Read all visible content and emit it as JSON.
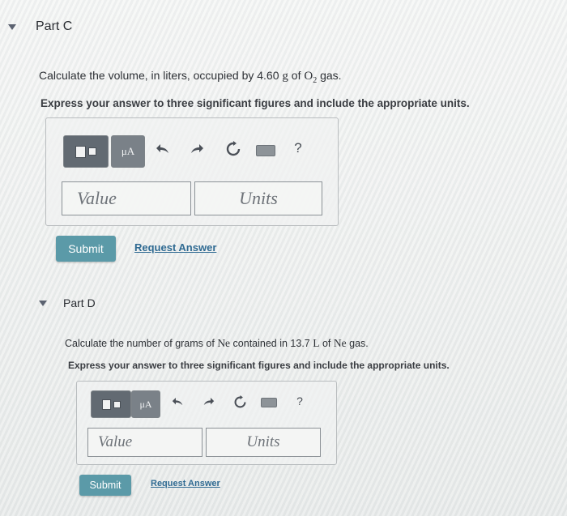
{
  "partC": {
    "title": "Part C",
    "question_pre": "Calculate the volume, in liters, occupied by 4.60",
    "unit_g": "g",
    "question_of": "of",
    "formula_base": "O",
    "formula_sub": "2",
    "question_post": "gas.",
    "instruction": "Express your answer to three significant figures and include the appropriate units.",
    "mu_label": "μA",
    "help_label": "?",
    "value_placeholder": "Value",
    "units_placeholder": "Units",
    "submit_label": "Submit",
    "request_answer_label": "Request Answer"
  },
  "partD": {
    "title": "Part D",
    "question_pre": "Calculate the number of grams of",
    "element1": "Ne",
    "question_mid": "contained in 13.7",
    "unit_L": "L",
    "question_of": "of",
    "element2": "Ne",
    "question_post": "gas.",
    "instruction": "Express your answer to three significant figures and include the appropriate units.",
    "mu_label": "μA",
    "help_label": "?",
    "value_placeholder": "Value",
    "units_placeholder": "Units",
    "submit_label": "Submit",
    "request_answer_label": "Request Answer"
  },
  "icons": {
    "collapse": "caret-down-icon",
    "template": "template-icon",
    "undo": "undo-icon",
    "redo": "redo-icon",
    "reset": "reset-icon",
    "keyboard": "keyboard-icon",
    "help": "help-icon"
  }
}
